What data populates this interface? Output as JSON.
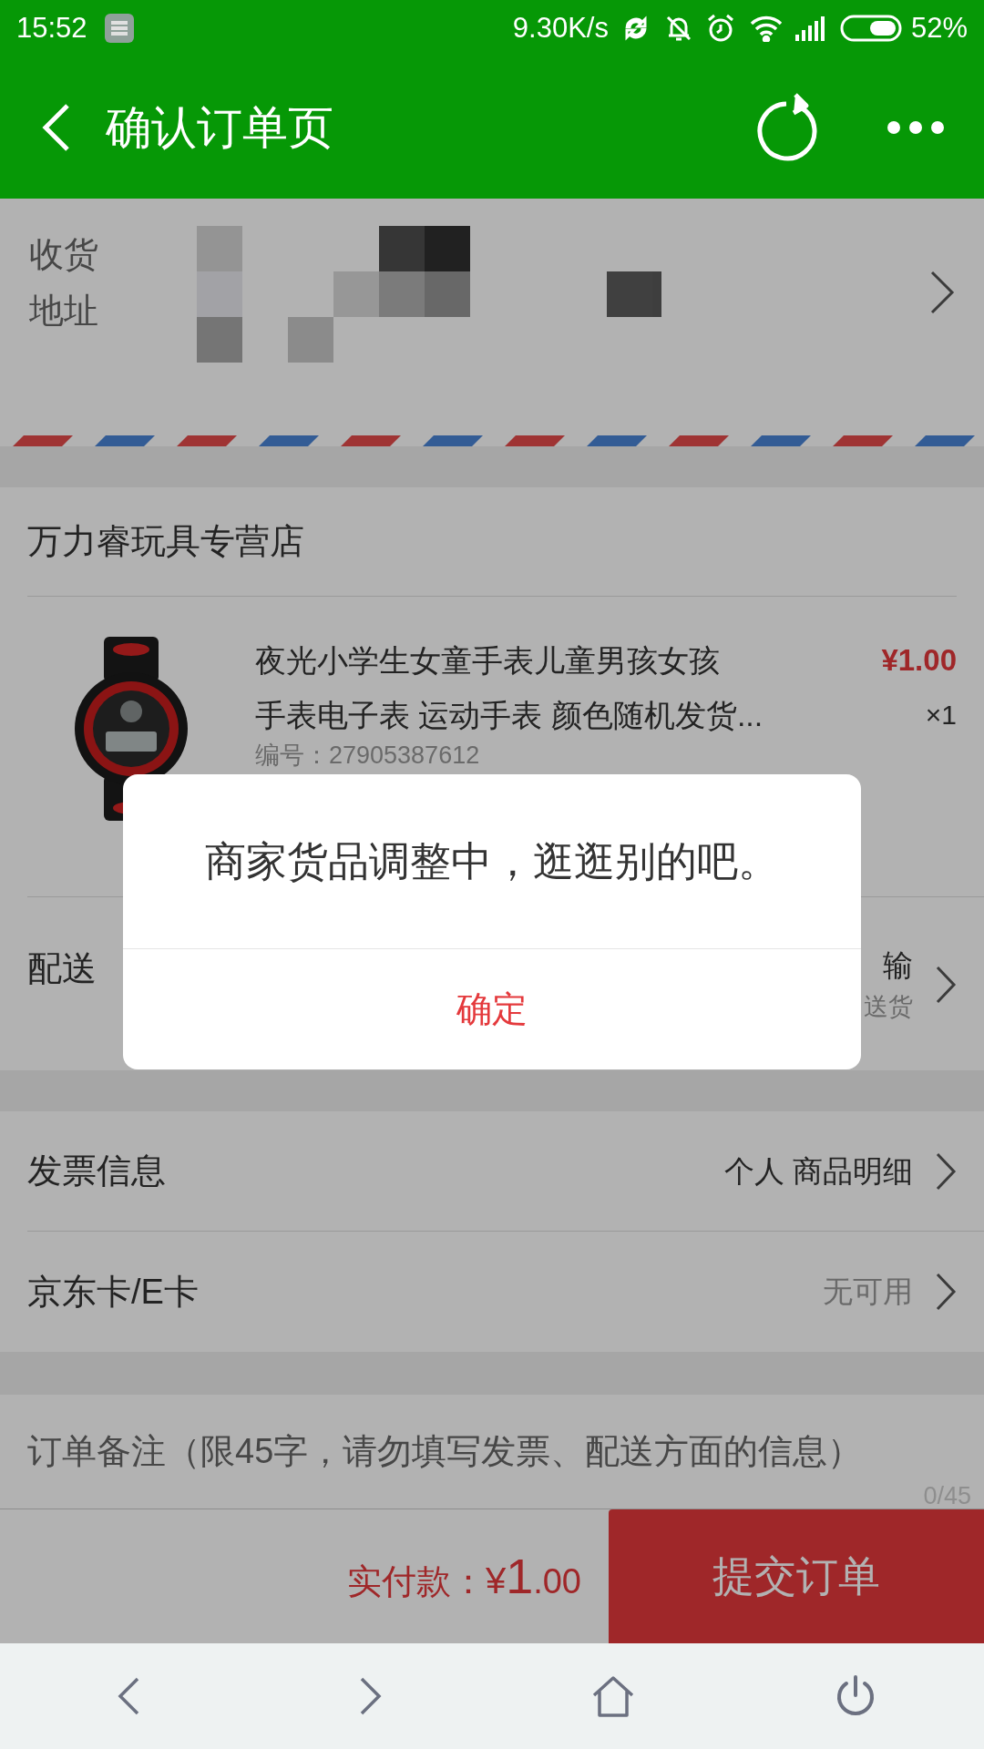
{
  "status_bar": {
    "time": "15:52",
    "net_speed": "9.30K/s",
    "battery": "52%"
  },
  "header": {
    "title": "确认订单页"
  },
  "address": {
    "label_lines": [
      "收货",
      "地址"
    ]
  },
  "store": {
    "name": "万力睿玩具专营店",
    "product": {
      "title_lines": [
        "夜光小学生女童手表儿童男孩女孩",
        "手表电子表 运动手表 颜色随机发货..."
      ],
      "code": "编号：27905387612",
      "price": "¥1.00",
      "quantity": "×1"
    },
    "delivery": {
      "label": "配送",
      "value": "输",
      "note": "送货"
    }
  },
  "rows": [
    {
      "label": "发票信息",
      "value": "个人 商品明细",
      "kind": "dark"
    },
    {
      "label": "京东卡/E卡",
      "value": "无可用",
      "kind": "muted"
    }
  ],
  "remark": {
    "placeholder": "订单备注（限45字，请勿填写发票、配送方面的信息）",
    "counter": "0/45"
  },
  "footer": {
    "total_label": "实付款：",
    "currency": "¥",
    "integer": "1",
    "decimal": ".00",
    "submit": "提交订单"
  },
  "dialog": {
    "message": "商家货品调整中，逛逛别的吧。",
    "confirm": "确定"
  }
}
